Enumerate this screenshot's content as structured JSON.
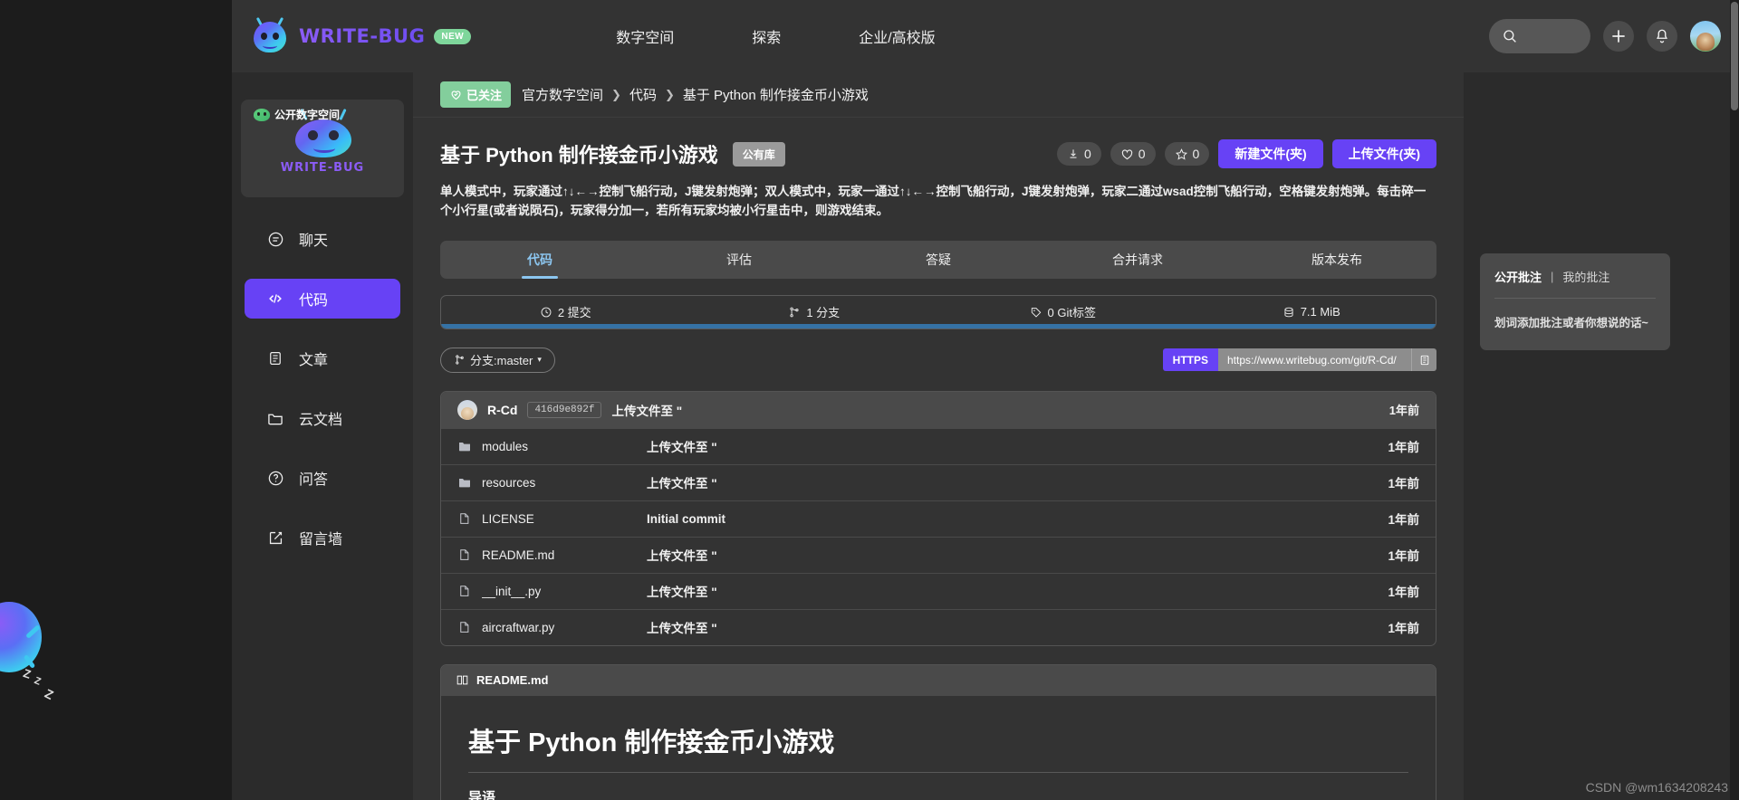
{
  "header": {
    "brand_name": "WRITE-BUG",
    "brand_badge": "NEW",
    "nav": [
      {
        "label": "数字空间"
      },
      {
        "label": "探索"
      },
      {
        "label": "企业/高校版"
      }
    ],
    "search_placeholder": "",
    "accent": "#6742f5"
  },
  "sidebar": {
    "space_tag": "公开数字空间",
    "space_name": "WRITE-BUG",
    "items": [
      {
        "label": "聊天",
        "icon": "chat-icon",
        "active": false
      },
      {
        "label": "代码",
        "icon": "code-icon",
        "active": true
      },
      {
        "label": "文章",
        "icon": "article-icon",
        "active": false
      },
      {
        "label": "云文档",
        "icon": "folder-icon",
        "active": false
      },
      {
        "label": "问答",
        "icon": "question-icon",
        "active": false
      },
      {
        "label": "留言墙",
        "icon": "edit-icon",
        "active": false
      }
    ]
  },
  "breadcrumb": {
    "follow_label": "已关注",
    "items": [
      "官方数字空间",
      "代码",
      "基于 Python 制作接金币小游戏"
    ],
    "separator": "❯"
  },
  "repo": {
    "title": "基于 Python 制作接金币小游戏",
    "visibility": "公有库",
    "stats": [
      {
        "icon": "download-icon",
        "value": "0"
      },
      {
        "icon": "heart-icon",
        "value": "0"
      },
      {
        "icon": "star-icon",
        "value": "0"
      }
    ],
    "buttons": {
      "new_file": "新建文件(夹)",
      "upload_file": "上传文件(夹)"
    },
    "description": "单人模式中，玩家通过↑↓←→控制飞船行动，J键发射炮弹；双人模式中，玩家一通过↑↓←→控制飞船行动，J键发射炮弹，玩家二通过wsad控制飞船行动，空格键发射炮弹。每击碎一个小行星(或者说陨石)，玩家得分加一，若所有玩家均被小行星击中，则游戏结束。"
  },
  "tabs": [
    {
      "label": "代码",
      "active": true
    },
    {
      "label": "评估",
      "active": false
    },
    {
      "label": "答疑",
      "active": false
    },
    {
      "label": "合并请求",
      "active": false
    },
    {
      "label": "版本发布",
      "active": false
    }
  ],
  "stats_bar": {
    "items": [
      {
        "icon": "clock-icon",
        "label": "2 提交"
      },
      {
        "icon": "branch-icon",
        "label": "1 分支"
      },
      {
        "icon": "tag-icon",
        "label": "0 Git标签"
      },
      {
        "icon": "database-icon",
        "label": "7.1 MiB"
      }
    ],
    "language_color": "#3572A5"
  },
  "clone": {
    "branch_label": "分支:master",
    "protocol": "HTTPS",
    "url": "https://www.writebug.com/git/R-Cd/",
    "copy_icon": "copy-icon"
  },
  "commit": {
    "author": "R-Cd",
    "hash": "416d9e892f",
    "message": "上传文件至 \"",
    "time": "1年前"
  },
  "files": [
    {
      "type": "folder",
      "name": "modules",
      "message": "上传文件至 \"",
      "time": "1年前"
    },
    {
      "type": "folder",
      "name": "resources",
      "message": "上传文件至 \"",
      "time": "1年前"
    },
    {
      "type": "file",
      "name": "LICENSE",
      "message": "Initial commit",
      "time": "1年前"
    },
    {
      "type": "file",
      "name": "README.md",
      "message": "上传文件至 \"",
      "time": "1年前"
    },
    {
      "type": "file",
      "name": "__init__.py",
      "message": "上传文件至 \"",
      "time": "1年前"
    },
    {
      "type": "file",
      "name": "aircraftwar.py",
      "message": "上传文件至 \"",
      "time": "1年前"
    }
  ],
  "readme": {
    "header": "README.md",
    "h1": "基于 Python 制作接金币小游戏",
    "h2": "导语"
  },
  "notes": {
    "public_tab": "公开批注",
    "divider": "|",
    "mine_tab": "我的批注",
    "hint": "划词添加批注或者你想说的话~"
  },
  "watermark": "CSDN @wm1634208243"
}
